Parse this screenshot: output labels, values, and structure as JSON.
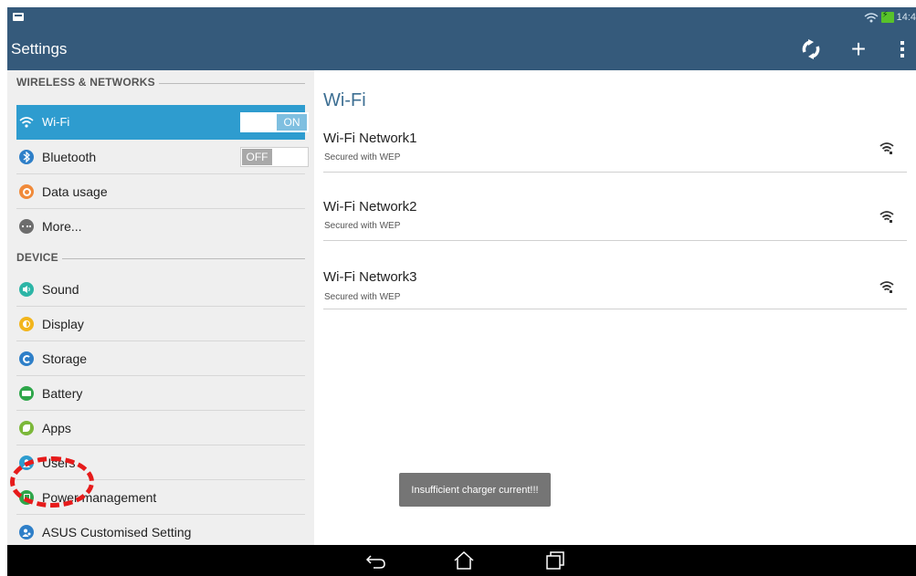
{
  "status_bar": {
    "time": "14:4"
  },
  "action_bar": {
    "title": "Settings"
  },
  "sections": {
    "wireless": "WIRELESS & NETWORKS",
    "device": "DEVICE"
  },
  "menu": {
    "wifi": {
      "label": "Wi-Fi",
      "toggle": "ON"
    },
    "bluetooth": {
      "label": "Bluetooth",
      "toggle": "OFF"
    },
    "data_usage": {
      "label": "Data usage"
    },
    "more": {
      "label": "More..."
    },
    "sound": {
      "label": "Sound"
    },
    "display": {
      "label": "Display"
    },
    "storage": {
      "label": "Storage"
    },
    "battery": {
      "label": "Battery"
    },
    "apps": {
      "label": "Apps"
    },
    "users": {
      "label": "Users"
    },
    "power": {
      "label": "Power management"
    },
    "asus": {
      "label": "ASUS Customised Setting"
    }
  },
  "wifi_panel": {
    "title": "Wi-Fi",
    "networks": [
      {
        "name": "Wi-Fi Network1",
        "security": "Secured with WEP"
      },
      {
        "name": "Wi-Fi Network2",
        "security": "Secured with WEP"
      },
      {
        "name": "Wi-Fi Network3",
        "security": "Secured with WEP"
      }
    ]
  },
  "toast": "Insufficient charger current!!!",
  "colors": {
    "action_bar": "#355a7b",
    "selected_row": "#2e9ccf",
    "highlight": "#e61b1b"
  }
}
